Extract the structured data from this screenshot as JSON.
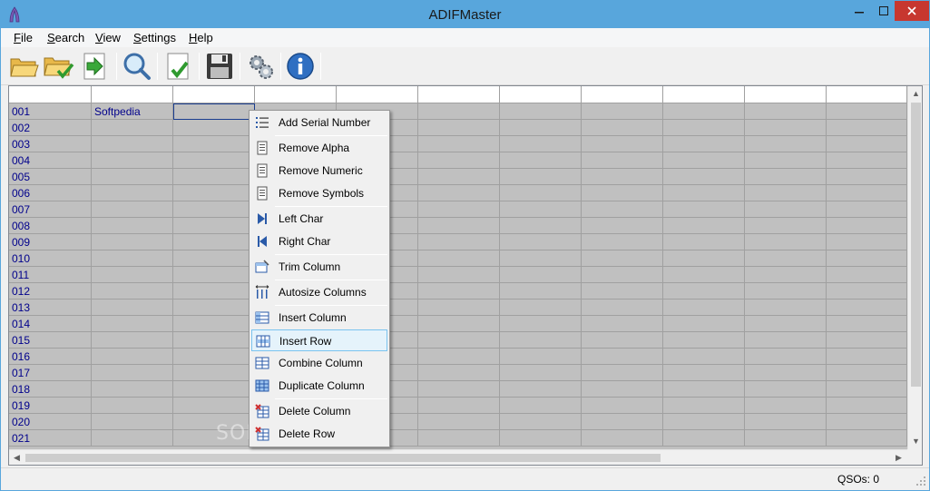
{
  "window": {
    "title": "ADIFMaster"
  },
  "menu": [
    {
      "mnemonic": "F",
      "rest": "ile"
    },
    {
      "mnemonic": "S",
      "rest": "earch"
    },
    {
      "mnemonic": "V",
      "rest": "iew"
    },
    {
      "mnemonic": "S",
      "rest": "ettings"
    },
    {
      "mnemonic": "H",
      "rest": "elp"
    }
  ],
  "toolbar": {
    "icons": [
      "open-folder-icon",
      "open-check-icon",
      "import-arrow-icon",
      "search-icon",
      "validate-check-icon",
      "save-disk-icon",
      "settings-gear-icon",
      "info-icon"
    ]
  },
  "grid": {
    "rows": [
      {
        "id": "001",
        "call": "Softpedia"
      },
      {
        "id": "002",
        "call": ""
      },
      {
        "id": "003",
        "call": ""
      },
      {
        "id": "004",
        "call": ""
      },
      {
        "id": "005",
        "call": ""
      },
      {
        "id": "006",
        "call": ""
      },
      {
        "id": "007",
        "call": ""
      },
      {
        "id": "008",
        "call": ""
      },
      {
        "id": "009",
        "call": ""
      },
      {
        "id": "010",
        "call": ""
      },
      {
        "id": "011",
        "call": ""
      },
      {
        "id": "012",
        "call": ""
      },
      {
        "id": "013",
        "call": ""
      },
      {
        "id": "014",
        "call": ""
      },
      {
        "id": "015",
        "call": ""
      },
      {
        "id": "016",
        "call": ""
      },
      {
        "id": "017",
        "call": ""
      },
      {
        "id": "018",
        "call": ""
      },
      {
        "id": "019",
        "call": ""
      },
      {
        "id": "020",
        "call": ""
      },
      {
        "id": "021",
        "call": ""
      }
    ]
  },
  "context_menu": {
    "items": [
      {
        "label": "Add Serial Number",
        "icon": "list-numbered-icon"
      },
      {
        "label": "Remove Alpha",
        "icon": "document-icon"
      },
      {
        "label": "Remove Numeric",
        "icon": "document-icon"
      },
      {
        "label": "Remove Symbols",
        "icon": "document-icon"
      },
      {
        "label": "Left Char",
        "icon": "skip-right-icon"
      },
      {
        "label": "Right Char",
        "icon": "skip-left-icon"
      },
      {
        "label": "Trim Column",
        "icon": "trim-column-icon"
      },
      {
        "label": "Autosize Columns",
        "icon": "autosize-columns-icon"
      },
      {
        "label": "Insert Column",
        "icon": "insert-column-icon"
      },
      {
        "label": "Insert Row",
        "icon": "insert-row-icon",
        "highlighted": true
      },
      {
        "label": "Combine Column",
        "icon": "combine-column-icon"
      },
      {
        "label": "Duplicate Column",
        "icon": "duplicate-column-icon"
      },
      {
        "label": "Delete Column",
        "icon": "delete-column-icon"
      },
      {
        "label": "Delete Row",
        "icon": "delete-row-icon"
      }
    ]
  },
  "status": {
    "qsos": "QSOs: 0"
  },
  "watermark": "SOFTPEDIA",
  "colors": {
    "titlebar": "#58a6dc",
    "close": "#c7372f",
    "grid": "#c0c0c0",
    "row_id_text": "#00008b",
    "hover": "#e5f3fb"
  }
}
